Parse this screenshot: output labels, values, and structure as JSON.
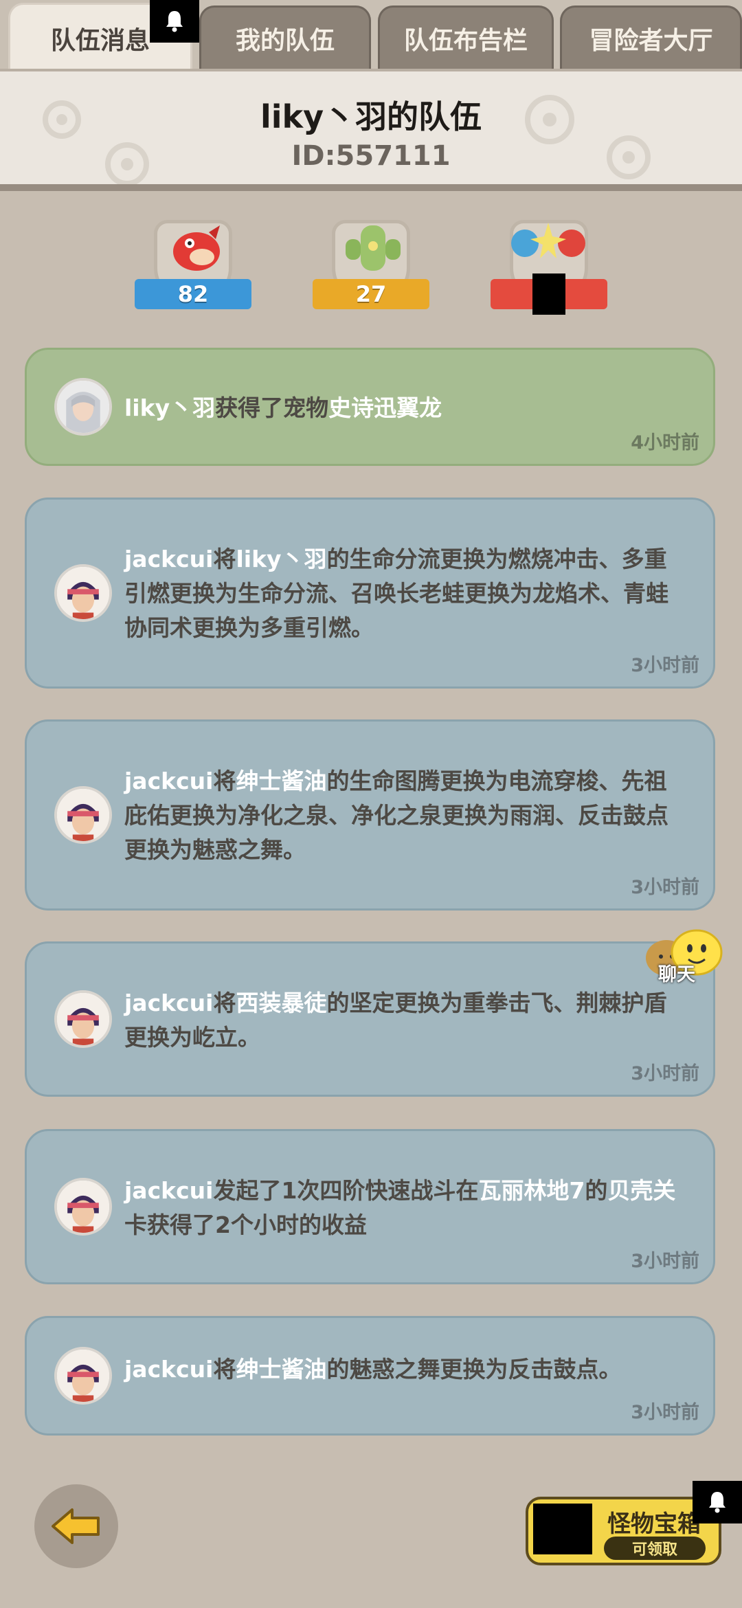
{
  "tabs": [
    {
      "label": "队伍消息",
      "active": true
    },
    {
      "label": "我的队伍",
      "active": false
    },
    {
      "label": "队伍布告栏",
      "active": false
    },
    {
      "label": "冒险者大厅",
      "active": false
    }
  ],
  "header": {
    "team_name": "liky丶羽的队伍",
    "team_id": "ID:557111"
  },
  "badges": [
    {
      "icon": "red-dragon-icon",
      "value": "82",
      "color": "#3c97d8"
    },
    {
      "icon": "green-cactus-icon",
      "value": "27",
      "color": "#e9a928"
    },
    {
      "icon": "battle-heroes-icon",
      "value": "",
      "color": "#e44b3e"
    }
  ],
  "messages": [
    {
      "style": "green",
      "avatar": "silver-hair-avatar",
      "parts": [
        {
          "t": "liky丶羽",
          "hl": true
        },
        {
          "t": "获得了宠物",
          "hl": false
        },
        {
          "t": "史诗迅翼龙",
          "hl": true
        }
      ],
      "time": "4小时前"
    },
    {
      "style": "blue",
      "avatar": "headband-avatar",
      "parts": [
        {
          "t": "jackcui",
          "hl": true
        },
        {
          "t": "将",
          "hl": false
        },
        {
          "t": "liky丶羽",
          "hl": true
        },
        {
          "t": "的生命分流更换为燃烧冲击、多重引燃更换为生命分流、召唤长老蛙更换为龙焰术、青蛙协同术更换为多重引燃。",
          "hl": false
        }
      ],
      "time": "3小时前"
    },
    {
      "style": "blue",
      "avatar": "headband-avatar",
      "parts": [
        {
          "t": "jackcui",
          "hl": true
        },
        {
          "t": "将",
          "hl": false
        },
        {
          "t": "绅士酱油",
          "hl": true
        },
        {
          "t": "的生命图腾更换为电流穿梭、先祖庇佑更换为净化之泉、净化之泉更换为雨润、反击鼓点更换为魅惑之舞。",
          "hl": false
        }
      ],
      "time": "3小时前"
    },
    {
      "style": "blue",
      "avatar": "headband-avatar",
      "parts": [
        {
          "t": "jackcui",
          "hl": true
        },
        {
          "t": "将",
          "hl": false
        },
        {
          "t": "西装暴徒",
          "hl": true
        },
        {
          "t": "的坚定更换为重拳击飞、荆棘护盾更换为屹立。",
          "hl": false
        }
      ],
      "time": "3小时前"
    },
    {
      "style": "blue",
      "avatar": "headband-avatar",
      "parts": [
        {
          "t": "jackcui",
          "hl": true
        },
        {
          "t": "发起了1次四阶快速战斗在",
          "hl": false
        },
        {
          "t": "瓦丽林地7",
          "hl": true
        },
        {
          "t": "的",
          "hl": false
        },
        {
          "t": "贝壳关",
          "hl": true
        },
        {
          "t": "卡获得了2个小时的收益",
          "hl": false
        }
      ],
      "time": "3小时前"
    },
    {
      "style": "blue",
      "avatar": "headband-avatar",
      "parts": [
        {
          "t": "jackcui",
          "hl": true
        },
        {
          "t": "将",
          "hl": false
        },
        {
          "t": "绅士酱油",
          "hl": true
        },
        {
          "t": "的魅惑之舞更换为反击鼓点。",
          "hl": false
        }
      ],
      "time": "3小时前"
    }
  ],
  "chat": {
    "label": "聊天"
  },
  "chest": {
    "title": "怪物宝箱",
    "claim": "可领取"
  },
  "icons": {
    "back": "back-arrow-icon",
    "bell": "bell-icon"
  }
}
